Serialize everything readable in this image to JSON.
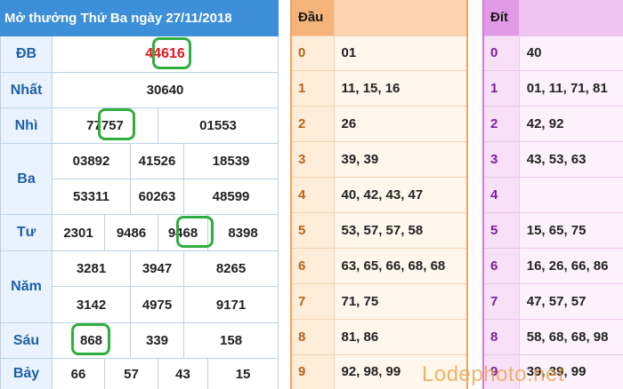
{
  "results": {
    "title": "Mở thưởng Thứ Ba ngày 27/11/2018",
    "rows": [
      {
        "label": "ĐB",
        "values": [
          "44616"
        ]
      },
      {
        "label": "Nhất",
        "values": [
          "30640"
        ]
      },
      {
        "label": "Nhì",
        "values": [
          "77757",
          "01553"
        ]
      },
      {
        "label": "Ba",
        "values": [
          "03892",
          "41526",
          "18539",
          "53311",
          "60263",
          "48599"
        ]
      },
      {
        "label": "Tư",
        "values": [
          "2301",
          "9486",
          "9468",
          "8398"
        ]
      },
      {
        "label": "Năm",
        "values": [
          "3281",
          "3947",
          "8265",
          "3142",
          "4975",
          "9171"
        ]
      },
      {
        "label": "Sáu",
        "values": [
          "868",
          "339",
          "158"
        ]
      },
      {
        "label": "Bảy",
        "values": [
          "66",
          "57",
          "43",
          "15"
        ]
      }
    ]
  },
  "dau": {
    "header": "Đầu",
    "rows": [
      {
        "key": "0",
        "value": "01"
      },
      {
        "key": "1",
        "value": "11, 15, 16"
      },
      {
        "key": "2",
        "value": "26"
      },
      {
        "key": "3",
        "value": "39, 39"
      },
      {
        "key": "4",
        "value": "40, 42, 43, 47"
      },
      {
        "key": "5",
        "value": "53, 57, 57, 58"
      },
      {
        "key": "6",
        "value": "63, 65, 66, 68, 68"
      },
      {
        "key": "7",
        "value": "71, 75"
      },
      {
        "key": "8",
        "value": "81, 86"
      },
      {
        "key": "9",
        "value": "92, 98, 99"
      }
    ]
  },
  "dit": {
    "header": "Đít",
    "rows": [
      {
        "key": "0",
        "value": "40"
      },
      {
        "key": "1",
        "value": "01, 11, 71, 81"
      },
      {
        "key": "2",
        "value": "42, 92"
      },
      {
        "key": "3",
        "value": "43, 53, 63"
      },
      {
        "key": "4",
        "value": ""
      },
      {
        "key": "5",
        "value": "15, 65, 75"
      },
      {
        "key": "6",
        "value": "16, 26, 66, 86"
      },
      {
        "key": "7",
        "value": "47, 57, 57"
      },
      {
        "key": "8",
        "value": "58, 68, 68, 98"
      },
      {
        "key": "9",
        "value": "39, 39, 99"
      }
    ]
  },
  "watermark": "Lodephoto.net",
  "colors": {
    "header_blue": "#3c8fd8",
    "prize_label": "#1d5fa8",
    "special_red": "#e3141c",
    "highlight_green": "#2fae3f",
    "dau_accent": "#f5b37a",
    "dit_accent": "#e39ae6"
  }
}
